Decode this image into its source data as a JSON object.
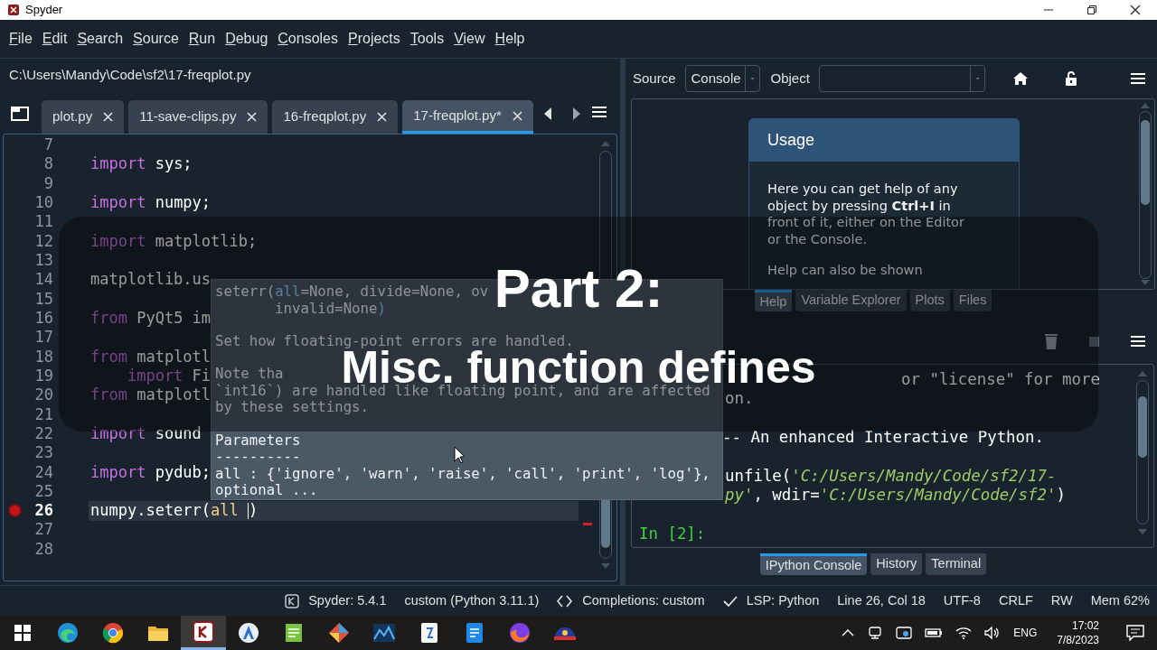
{
  "window": {
    "title": "Spyder"
  },
  "menu": [
    "File",
    "Edit",
    "Search",
    "Source",
    "Run",
    "Debug",
    "Consoles",
    "Projects",
    "Tools",
    "View",
    "Help"
  ],
  "editor": {
    "path": "C:\\Users\\Mandy\\Code\\sf2\\17-freqplot.py",
    "tabs": [
      {
        "label": "plot.py",
        "selected": false
      },
      {
        "label": "11-save-clips.py",
        "selected": false
      },
      {
        "label": "16-freqplot.py",
        "selected": false
      },
      {
        "label": "17-freqplot.py*",
        "selected": true
      }
    ],
    "lines": [
      {
        "number": "7",
        "breakpoint": false,
        "current": false
      },
      {
        "number": "8",
        "breakpoint": false,
        "current": false,
        "tokens": [
          {
            "kind": "kw",
            "text": "import"
          },
          {
            "kind": "plain",
            "text": " sys;"
          }
        ]
      },
      {
        "number": "9",
        "breakpoint": false,
        "current": false
      },
      {
        "number": "10",
        "breakpoint": false,
        "current": false,
        "tokens": [
          {
            "kind": "kw",
            "text": "import"
          },
          {
            "kind": "plain",
            "text": " numpy;"
          }
        ]
      },
      {
        "number": "11",
        "breakpoint": false,
        "current": false
      },
      {
        "number": "12",
        "breakpoint": false,
        "current": false,
        "tokens": [
          {
            "kind": "kw",
            "text": "import"
          },
          {
            "kind": "plain",
            "text": " matplotlib;"
          }
        ]
      },
      {
        "number": "13",
        "breakpoint": false,
        "current": false
      },
      {
        "number": "14",
        "breakpoint": false,
        "current": false,
        "tokens": [
          {
            "kind": "plain",
            "text": "matplotlib.us"
          }
        ]
      },
      {
        "number": "15",
        "breakpoint": false,
        "current": false
      },
      {
        "number": "16",
        "breakpoint": false,
        "current": false,
        "tokens": [
          {
            "kind": "kw",
            "text": "from"
          },
          {
            "kind": "plain",
            "text": " PyQt5 im"
          }
        ]
      },
      {
        "number": "17",
        "breakpoint": false,
        "current": false
      },
      {
        "number": "18",
        "breakpoint": false,
        "current": false,
        "tokens": [
          {
            "kind": "kw",
            "text": "from"
          },
          {
            "kind": "plain",
            "text": " matplotl"
          }
        ]
      },
      {
        "number": "19",
        "breakpoint": false,
        "current": false,
        "tokens": [
          {
            "kind": "kw",
            "text": "    import"
          },
          {
            "kind": "plain",
            "text": " Fi"
          }
        ]
      },
      {
        "number": "20",
        "breakpoint": false,
        "current": false,
        "tokens": [
          {
            "kind": "kw",
            "text": "from"
          },
          {
            "kind": "plain",
            "text": " matplotl"
          }
        ]
      },
      {
        "number": "21",
        "breakpoint": false,
        "current": false
      },
      {
        "number": "22",
        "breakpoint": false,
        "current": false,
        "tokens": [
          {
            "kind": "kw",
            "text": "import"
          },
          {
            "kind": "plain",
            "text": " sound"
          }
        ]
      },
      {
        "number": "23",
        "breakpoint": false,
        "current": false
      },
      {
        "number": "24",
        "breakpoint": false,
        "current": false,
        "tokens": [
          {
            "kind": "kw",
            "text": "import"
          },
          {
            "kind": "plain",
            "text": " pydub;"
          }
        ]
      },
      {
        "number": "25",
        "breakpoint": false,
        "current": false
      },
      {
        "number": "26",
        "breakpoint": true,
        "current": true,
        "tokens": [
          {
            "kind": "plain",
            "text": "numpy.seterr("
          },
          {
            "kind": "arg",
            "text": "all "
          },
          {
            "kind": "cursor"
          },
          {
            "kind": "plain",
            "text": ")"
          }
        ]
      },
      {
        "number": "27",
        "breakpoint": false,
        "current": false
      },
      {
        "number": "28",
        "breakpoint": false,
        "current": false
      }
    ]
  },
  "calltip": {
    "lines": [
      {
        "kind": "code",
        "tokens": [
          {
            "kind": "plain",
            "text": "seterr("
          },
          {
            "kind": "param",
            "text": "all"
          },
          {
            "kind": "plain",
            "text": "=None, divide=None, ov"
          }
        ]
      },
      {
        "kind": "code",
        "tokens": [
          {
            "kind": "plain",
            "text": "       invalid=None"
          },
          {
            "kind": "param",
            "text": ")"
          }
        ]
      },
      {
        "kind": "blank"
      },
      {
        "kind": "text",
        "text": "Set how floating-point errors are handled."
      },
      {
        "kind": "blank"
      },
      {
        "kind": "text",
        "text": "Note tha"
      },
      {
        "kind": "text",
        "text": "`int16`) are handled like floating point, and are affected"
      },
      {
        "kind": "text",
        "text": "by these settings."
      },
      {
        "kind": "blank"
      },
      {
        "kind": "text",
        "text": "Parameters"
      },
      {
        "kind": "text",
        "text": "----------"
      },
      {
        "kind": "text",
        "text": "all : {'ignore', 'warn', 'raise', 'call', 'print', 'log'},"
      },
      {
        "kind": "text",
        "text": "optional ..."
      }
    ]
  },
  "help": {
    "source_label": "Source",
    "source_value": "Console",
    "object_label": "Object",
    "card": {
      "title": "Usage",
      "paragraphs": [
        "Here you can get help of any object by pressing **Ctrl+I** in front of it, either on the Editor or the Console.",
        "Help can also be shown"
      ]
    },
    "tabs": [
      {
        "label": "Help",
        "selected": true
      },
      {
        "label": "Variable Explorer",
        "selected": false
      },
      {
        "label": "Plots",
        "selected": false
      },
      {
        "label": "Files",
        "selected": false
      }
    ]
  },
  "console": {
    "lines": [
      {
        "kind": "text",
        "tokens": [
          {
            "kind": "plain",
            "text": "or \"license\" for more"
          }
        ]
      },
      {
        "kind": "text",
        "tokens": [
          {
            "kind": "plain",
            "text": "on."
          }
        ]
      },
      {
        "kind": "blank"
      },
      {
        "kind": "text",
        "tokens": [
          {
            "kind": "plain",
            "text": "-- An enhanced Interactive Python."
          }
        ]
      },
      {
        "kind": "blank"
      },
      {
        "kind": "text",
        "tokens": [
          {
            "kind": "plain",
            "text": "unfile("
          },
          {
            "kind": "string",
            "text": "'C:/Users/Mandy/Code/sf2/17-"
          }
        ]
      },
      {
        "kind": "text",
        "tokens": [
          {
            "kind": "string",
            "text": "py'"
          },
          {
            "kind": "plain",
            "text": ", wdir="
          },
          {
            "kind": "string",
            "text": "'C:/Users/Mandy/Code/sf2'"
          },
          {
            "kind": "plain",
            "text": ")"
          }
        ]
      },
      {
        "kind": "blank"
      },
      {
        "kind": "text",
        "tokens": [
          {
            "kind": "prompt",
            "text": "In [2]:"
          }
        ]
      }
    ],
    "tabs": [
      {
        "label": "IPython Console",
        "selected": true
      },
      {
        "label": "History",
        "selected": false
      },
      {
        "label": "Terminal",
        "selected": false
      }
    ]
  },
  "overlay": {
    "title_lines": [
      "Part 2:",
      "Misc. function defines"
    ]
  },
  "status_bar": [
    {
      "kind": "app",
      "text": "Spyder: 5.4.1"
    },
    {
      "kind": "plain",
      "text": "custom (Python 3.11.1)"
    },
    {
      "kind": "completions",
      "text": "Completions: custom"
    },
    {
      "kind": "check",
      "text": "LSP: Python"
    },
    {
      "kind": "plain",
      "text": "Line 26, Col 18"
    },
    {
      "kind": "plain",
      "text": "UTF-8"
    },
    {
      "kind": "plain",
      "text": "CRLF"
    },
    {
      "kind": "plain",
      "text": "RW"
    },
    {
      "kind": "plain",
      "text": "Mem 62%"
    }
  ],
  "taskbar": {
    "apps": [
      {
        "kind": "start",
        "selected": false
      },
      {
        "kind": "wave",
        "selected": false
      },
      {
        "kind": "ball",
        "selected": false
      },
      {
        "kind": "folder",
        "selected": false
      },
      {
        "kind": "spyder",
        "selected": true
      },
      {
        "kind": "compass",
        "selected": false
      },
      {
        "kind": "notepad",
        "selected": false
      },
      {
        "kind": "diamond",
        "selected": false
      },
      {
        "kind": "chart",
        "selected": false
      },
      {
        "kind": "doc",
        "selected": false
      },
      {
        "kind": "bluedoc",
        "selected": false
      },
      {
        "kind": "fox",
        "selected": false
      },
      {
        "kind": "helmet",
        "selected": false
      }
    ],
    "language": "ENG",
    "time": "17:02",
    "date": "7/8/2023"
  }
}
